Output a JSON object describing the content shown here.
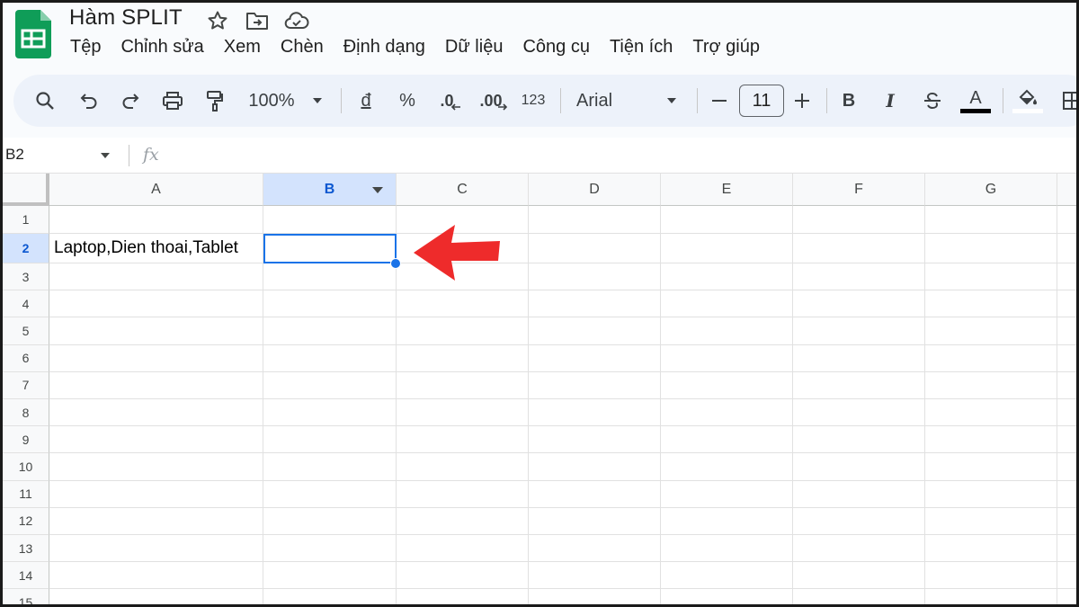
{
  "doc": {
    "title": "Hàm SPLIT",
    "menu": [
      "Tệp",
      "Chỉnh sửa",
      "Xem",
      "Chèn",
      "Định dạng",
      "Dữ liệu",
      "Công cụ",
      "Tiện ích",
      "Trợ giúp"
    ]
  },
  "toolbar": {
    "zoom": "100%",
    "currency": "đ",
    "percent": "%",
    "decrease_decimal": ".0",
    "increase_decimal": ".00",
    "format_123": "123",
    "font": "Arial",
    "font_size": "11",
    "bold": "B",
    "italic": "I",
    "text_color": "A"
  },
  "formula_bar": {
    "name_box": "B2",
    "fx": "fx",
    "content": ""
  },
  "grid": {
    "columns": [
      "A",
      "B",
      "C",
      "D",
      "E",
      "F",
      "G"
    ],
    "rows": [
      "1",
      "2",
      "3",
      "4",
      "5",
      "6",
      "7",
      "8",
      "9",
      "10",
      "11",
      "12",
      "13",
      "14",
      "15"
    ],
    "selected_cell": "B2",
    "cell_A2": "Laptop,Dien thoai,Tablet"
  },
  "colors": {
    "accent": "#1a73e8",
    "selected_header": "#d3e3fd",
    "arrow": "#ee2b2b",
    "sheets_green": "#0f9d58"
  }
}
